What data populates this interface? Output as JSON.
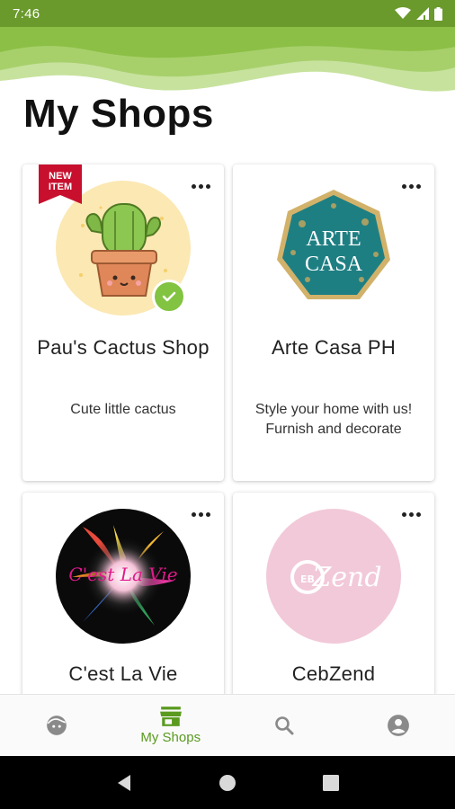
{
  "status_bar": {
    "time": "7:46"
  },
  "page": {
    "title": "My Shops"
  },
  "shops": [
    {
      "name": "Pau's Cactus Shop",
      "description": "Cute little cactus",
      "ribbon": "NEW\nITEM",
      "verified": true
    },
    {
      "name": "Arte Casa PH",
      "description": "Style your home with us!\nFurnish and decorate",
      "logo_text_1": "ARTE",
      "logo_text_2": "CASA"
    },
    {
      "name": "C'est La Vie",
      "description": "",
      "logo_text": "C'est La Vie"
    },
    {
      "name": "CebZend",
      "description": "",
      "logo_text": "Zend",
      "logo_mark": "EB"
    }
  ],
  "bottom_nav": {
    "items": [
      {
        "icon": "face-icon",
        "label": ""
      },
      {
        "icon": "store-icon",
        "label": "My Shops",
        "active": true
      },
      {
        "icon": "search-icon",
        "label": ""
      },
      {
        "icon": "account-icon",
        "label": ""
      }
    ]
  },
  "colors": {
    "brand_green": "#6a9a2c",
    "active_green": "#5a9a1f",
    "badge_green": "#82c341",
    "ribbon_red": "#c8102e"
  }
}
